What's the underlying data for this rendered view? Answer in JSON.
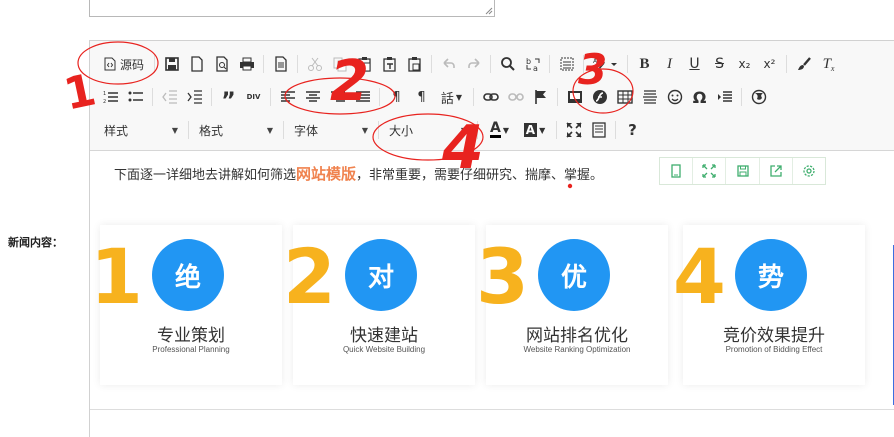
{
  "form": {
    "news_content_label": "新闻内容："
  },
  "toolbar": {
    "source_label": "源码",
    "row3": {
      "style_label": "样式",
      "format_label": "格式",
      "font_label": "字体",
      "size_label": "大小",
      "font_color_label": "A",
      "bg_color_label": "A"
    },
    "text_glyphs": {
      "bold": "B",
      "italic": "I",
      "underline": "U",
      "strike": "S",
      "sub": "x₂",
      "sup": "x²",
      "clear": "T",
      "quote": "”",
      "div": "DIV",
      "ltr": "¶",
      "rtl": "¶",
      "lang": "話",
      "omega": "Ω",
      "help": "?",
      "spell": "ABC"
    }
  },
  "content": {
    "intro_before": "下面逐一详细地去讲解如何筛选",
    "intro_highlight": "网站模版",
    "intro_after": "，非常重要，需要仔细研究、揣摩、掌握。",
    "features": [
      {
        "num": "1",
        "char": "绝",
        "title": "专业策划",
        "subtitle": "Professional Planning"
      },
      {
        "num": "2",
        "char": "对",
        "title": "快速建站",
        "subtitle": "Quick Website Building"
      },
      {
        "num": "3",
        "char": "优",
        "title": "网站排名优化",
        "subtitle": "Website Ranking Optimization"
      },
      {
        "num": "4",
        "char": "势",
        "title": "竞价效果提升",
        "subtitle": "Promotion of Bidding Effect"
      }
    ]
  },
  "annotations": {
    "a1": "1",
    "a2": "2",
    "a3": "3",
    "a4": "4"
  },
  "colors": {
    "accent_blue": "#2196f3",
    "number_yellow": "#f7b21e",
    "highlight_orange": "#f0834f",
    "annotation_red": "#e8231f",
    "toolbar_green": "#3fae6e"
  }
}
